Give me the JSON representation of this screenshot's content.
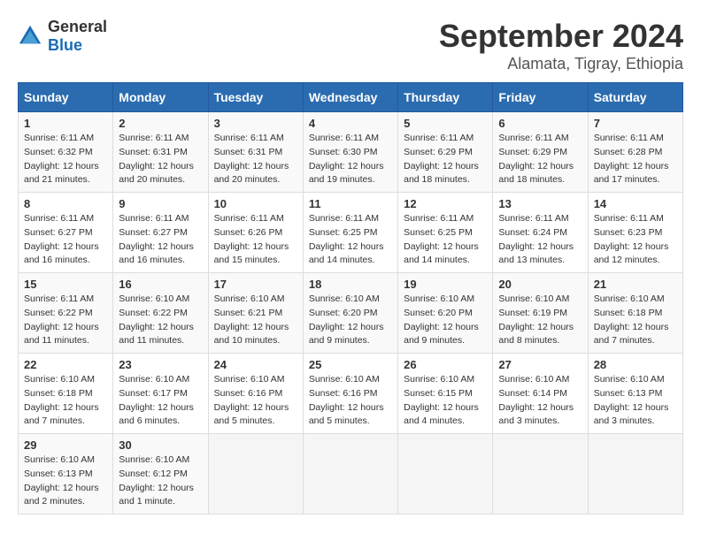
{
  "logo": {
    "general": "General",
    "blue": "Blue"
  },
  "title": "September 2024",
  "location": "Alamata, Tigray, Ethiopia",
  "days_of_week": [
    "Sunday",
    "Monday",
    "Tuesday",
    "Wednesday",
    "Thursday",
    "Friday",
    "Saturday"
  ],
  "weeks": [
    [
      {
        "day": "1",
        "sunrise": "6:11 AM",
        "sunset": "6:32 PM",
        "daylight": "12 hours and 21 minutes."
      },
      {
        "day": "2",
        "sunrise": "6:11 AM",
        "sunset": "6:31 PM",
        "daylight": "12 hours and 20 minutes."
      },
      {
        "day": "3",
        "sunrise": "6:11 AM",
        "sunset": "6:31 PM",
        "daylight": "12 hours and 20 minutes."
      },
      {
        "day": "4",
        "sunrise": "6:11 AM",
        "sunset": "6:30 PM",
        "daylight": "12 hours and 19 minutes."
      },
      {
        "day": "5",
        "sunrise": "6:11 AM",
        "sunset": "6:29 PM",
        "daylight": "12 hours and 18 minutes."
      },
      {
        "day": "6",
        "sunrise": "6:11 AM",
        "sunset": "6:29 PM",
        "daylight": "12 hours and 18 minutes."
      },
      {
        "day": "7",
        "sunrise": "6:11 AM",
        "sunset": "6:28 PM",
        "daylight": "12 hours and 17 minutes."
      }
    ],
    [
      {
        "day": "8",
        "sunrise": "6:11 AM",
        "sunset": "6:27 PM",
        "daylight": "12 hours and 16 minutes."
      },
      {
        "day": "9",
        "sunrise": "6:11 AM",
        "sunset": "6:27 PM",
        "daylight": "12 hours and 16 minutes."
      },
      {
        "day": "10",
        "sunrise": "6:11 AM",
        "sunset": "6:26 PM",
        "daylight": "12 hours and 15 minutes."
      },
      {
        "day": "11",
        "sunrise": "6:11 AM",
        "sunset": "6:25 PM",
        "daylight": "12 hours and 14 minutes."
      },
      {
        "day": "12",
        "sunrise": "6:11 AM",
        "sunset": "6:25 PM",
        "daylight": "12 hours and 14 minutes."
      },
      {
        "day": "13",
        "sunrise": "6:11 AM",
        "sunset": "6:24 PM",
        "daylight": "12 hours and 13 minutes."
      },
      {
        "day": "14",
        "sunrise": "6:11 AM",
        "sunset": "6:23 PM",
        "daylight": "12 hours and 12 minutes."
      }
    ],
    [
      {
        "day": "15",
        "sunrise": "6:11 AM",
        "sunset": "6:22 PM",
        "daylight": "12 hours and 11 minutes."
      },
      {
        "day": "16",
        "sunrise": "6:10 AM",
        "sunset": "6:22 PM",
        "daylight": "12 hours and 11 minutes."
      },
      {
        "day": "17",
        "sunrise": "6:10 AM",
        "sunset": "6:21 PM",
        "daylight": "12 hours and 10 minutes."
      },
      {
        "day": "18",
        "sunrise": "6:10 AM",
        "sunset": "6:20 PM",
        "daylight": "12 hours and 9 minutes."
      },
      {
        "day": "19",
        "sunrise": "6:10 AM",
        "sunset": "6:20 PM",
        "daylight": "12 hours and 9 minutes."
      },
      {
        "day": "20",
        "sunrise": "6:10 AM",
        "sunset": "6:19 PM",
        "daylight": "12 hours and 8 minutes."
      },
      {
        "day": "21",
        "sunrise": "6:10 AM",
        "sunset": "6:18 PM",
        "daylight": "12 hours and 7 minutes."
      }
    ],
    [
      {
        "day": "22",
        "sunrise": "6:10 AM",
        "sunset": "6:18 PM",
        "daylight": "12 hours and 7 minutes."
      },
      {
        "day": "23",
        "sunrise": "6:10 AM",
        "sunset": "6:17 PM",
        "daylight": "12 hours and 6 minutes."
      },
      {
        "day": "24",
        "sunrise": "6:10 AM",
        "sunset": "6:16 PM",
        "daylight": "12 hours and 5 minutes."
      },
      {
        "day": "25",
        "sunrise": "6:10 AM",
        "sunset": "6:16 PM",
        "daylight": "12 hours and 5 minutes."
      },
      {
        "day": "26",
        "sunrise": "6:10 AM",
        "sunset": "6:15 PM",
        "daylight": "12 hours and 4 minutes."
      },
      {
        "day": "27",
        "sunrise": "6:10 AM",
        "sunset": "6:14 PM",
        "daylight": "12 hours and 3 minutes."
      },
      {
        "day": "28",
        "sunrise": "6:10 AM",
        "sunset": "6:13 PM",
        "daylight": "12 hours and 3 minutes."
      }
    ],
    [
      {
        "day": "29",
        "sunrise": "6:10 AM",
        "sunset": "6:13 PM",
        "daylight": "12 hours and 2 minutes."
      },
      {
        "day": "30",
        "sunrise": "6:10 AM",
        "sunset": "6:12 PM",
        "daylight": "12 hours and 1 minute."
      },
      null,
      null,
      null,
      null,
      null
    ]
  ]
}
